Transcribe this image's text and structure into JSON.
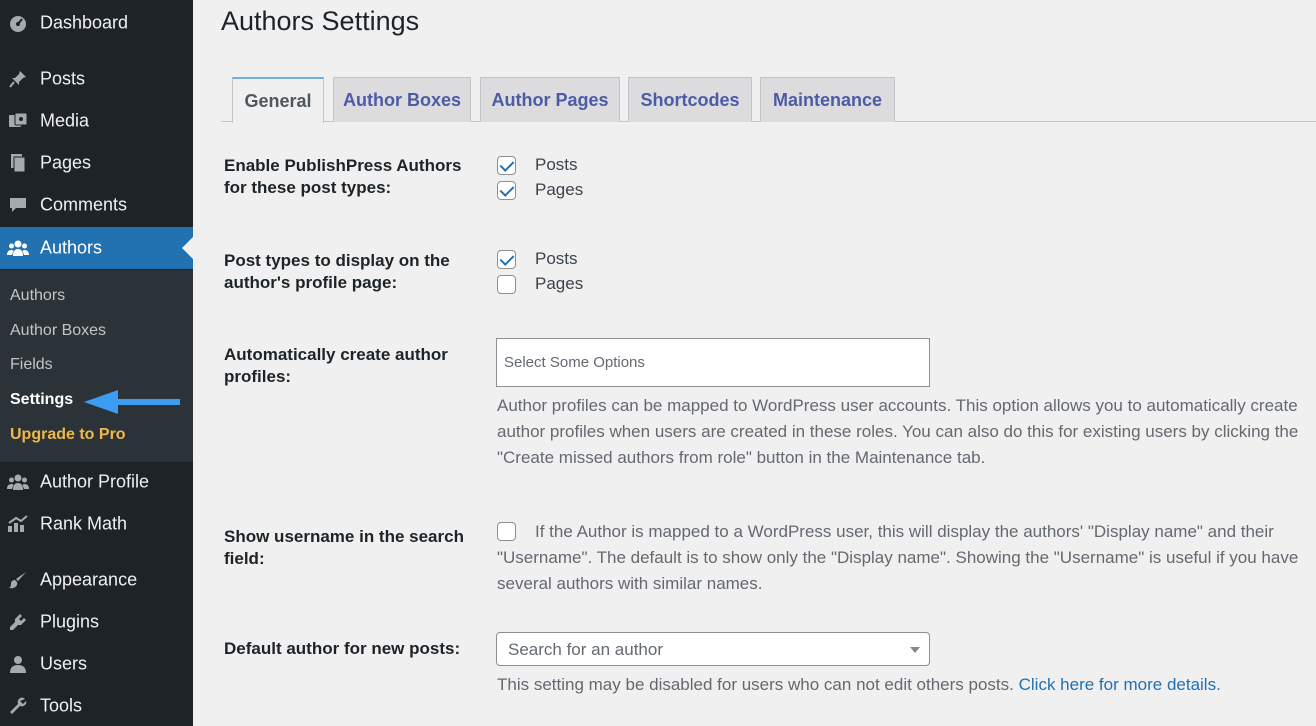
{
  "sidebar": {
    "menu": [
      {
        "label": "Dashboard",
        "icon": "dashboard-icon"
      },
      {
        "label": "Posts",
        "icon": "pushpin-icon"
      },
      {
        "label": "Media",
        "icon": "media-icon"
      },
      {
        "label": "Pages",
        "icon": "pages-icon"
      },
      {
        "label": "Comments",
        "icon": "comments-icon"
      },
      {
        "label": "Authors",
        "icon": "users-group-icon"
      },
      {
        "label": "Author Profile",
        "icon": "users-group-icon"
      },
      {
        "label": "Rank Math",
        "icon": "rank-math-icon"
      },
      {
        "label": "Appearance",
        "icon": "paintbrush-icon"
      },
      {
        "label": "Plugins",
        "icon": "plugin-icon"
      },
      {
        "label": "Users",
        "icon": "user-icon"
      },
      {
        "label": "Tools",
        "icon": "wrench-icon"
      }
    ],
    "submenu": [
      "Authors",
      "Author Boxes",
      "Fields",
      "Settings",
      "Upgrade to Pro"
    ]
  },
  "main": {
    "title": "Authors Settings",
    "tabs": [
      "General",
      "Author Boxes",
      "Author Pages",
      "Shortcodes",
      "Maintenance"
    ],
    "enable_post_types": {
      "label": "Enable PublishPress Authors for these post types:",
      "options": [
        {
          "label": "Posts",
          "checked": true
        },
        {
          "label": "Pages",
          "checked": true
        }
      ]
    },
    "display_post_types": {
      "label": "Post types to display on the author's profile page:",
      "options": [
        {
          "label": "Posts",
          "checked": true
        },
        {
          "label": "Pages",
          "checked": false
        }
      ]
    },
    "auto_create": {
      "label": "Automatically create author profiles:",
      "placeholder": "Select Some Options",
      "description": "Author profiles can be mapped to WordPress user accounts. This option allows you to automatically create author profiles when users are created in these roles. You can also do this for existing users by clicking the \"Create missed authors from role\" button in the Maintenance tab."
    },
    "show_username": {
      "label": "Show username in the search field:",
      "checked": false,
      "description": "If the Author is mapped to a WordPress user, this will display the authors' \"Display name\" and their \"Username\". The default is to show only the \"Display name\". Showing the \"Username\" is useful if you have several authors with similar names."
    },
    "default_author": {
      "label": "Default author for new posts:",
      "placeholder": "Search for an author",
      "description": "This setting may be disabled for users who can not edit others posts.",
      "link": "Click here for more details."
    }
  },
  "colors": {
    "sidebar_bg": "#1d2327",
    "active": "#2271b1",
    "upgrade": "#f0b849",
    "arrow": "#3b9cf0"
  }
}
